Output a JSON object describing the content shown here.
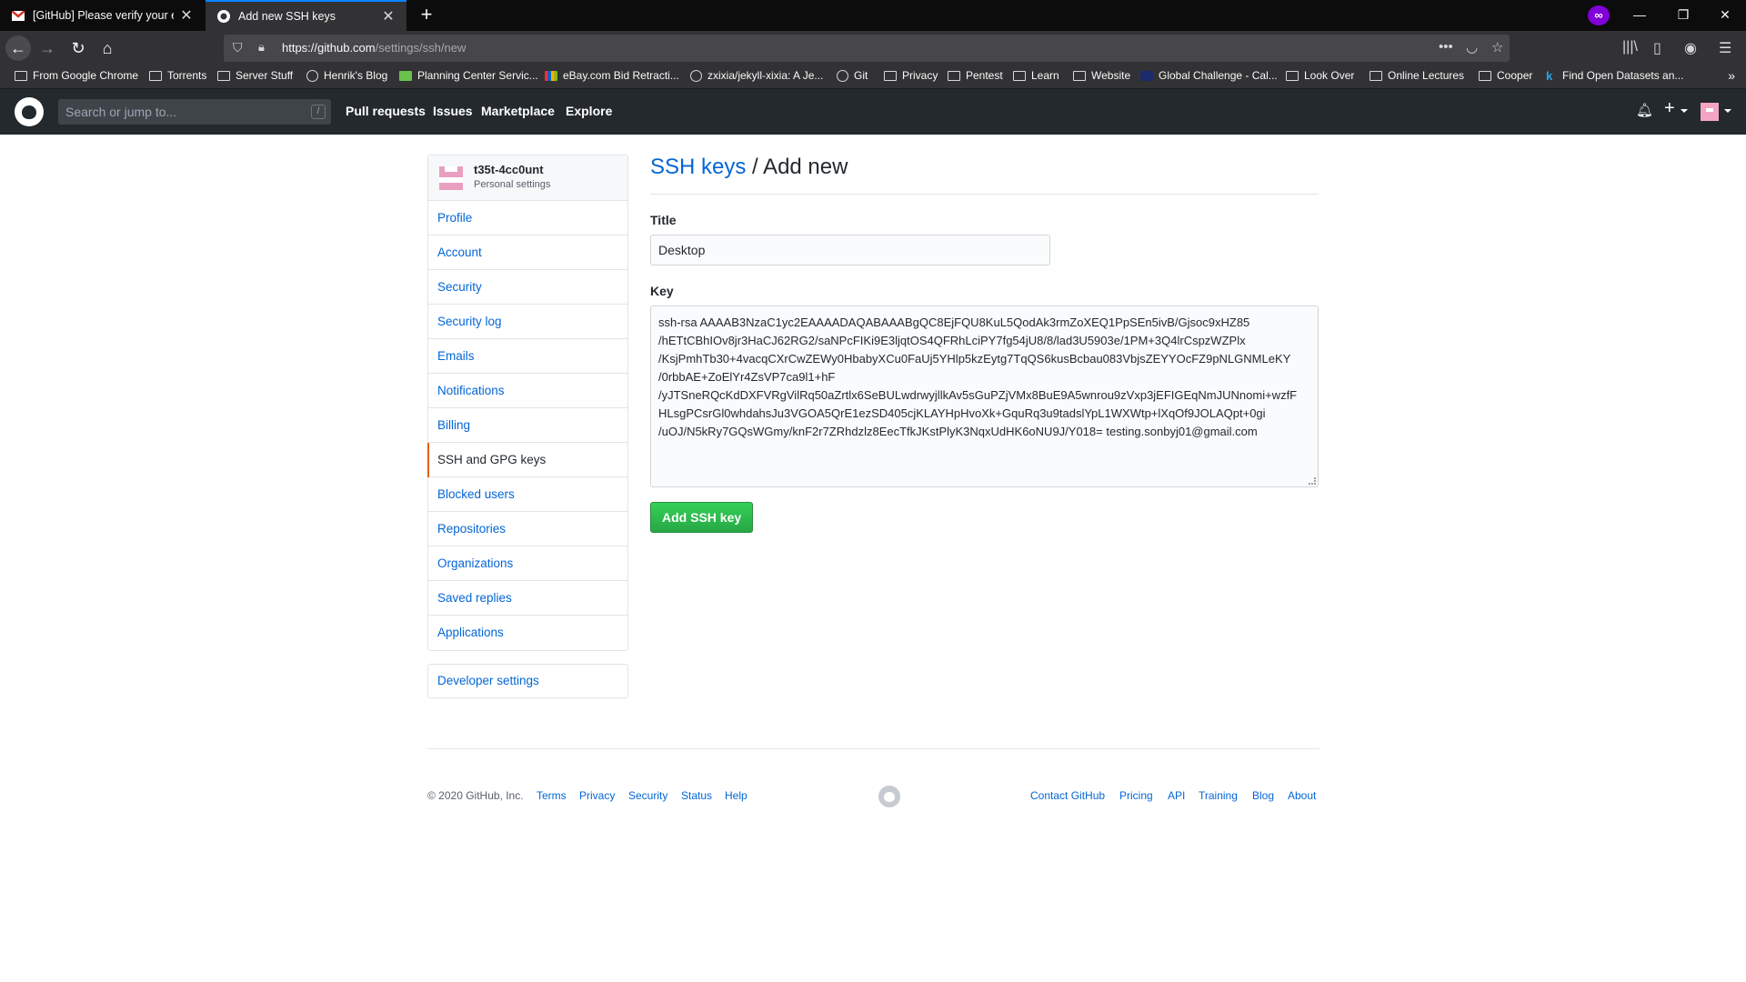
{
  "browser": {
    "tabs": [
      {
        "title": "[GitHub] Please verify your em",
        "icon": "gmail-icon"
      },
      {
        "title": "Add new SSH keys",
        "icon": "github-icon"
      }
    ],
    "url_host": "https://github.com",
    "url_path": "/settings/ssh/new",
    "bookmarks": [
      "From Google Chrome",
      "Torrents",
      "Server Stuff",
      "Henrik's Blog",
      "Planning Center Servic...",
      "eBay.com Bid Retracti...",
      "zxixia/jekyll-xixia: A Je...",
      "Git",
      "Privacy",
      "Pentest",
      "Learn",
      "Website",
      "Global Challenge - Cal...",
      "Look Over",
      "Online Lectures",
      "Cooper",
      "Find Open Datasets an..."
    ]
  },
  "github": {
    "search_placeholder": "Search or jump to...",
    "search_shortcut": "/",
    "nav": [
      "Pull requests",
      "Issues",
      "Marketplace",
      "Explore"
    ]
  },
  "sidebar": {
    "username": "t35t-4cc0unt",
    "subtitle": "Personal settings",
    "items": [
      {
        "label": "Profile",
        "selected": false
      },
      {
        "label": "Account",
        "selected": false
      },
      {
        "label": "Security",
        "selected": false
      },
      {
        "label": "Security log",
        "selected": false
      },
      {
        "label": "Emails",
        "selected": false
      },
      {
        "label": "Notifications",
        "selected": false
      },
      {
        "label": "Billing",
        "selected": false
      },
      {
        "label": "SSH and GPG keys",
        "selected": true
      },
      {
        "label": "Blocked users",
        "selected": false
      },
      {
        "label": "Repositories",
        "selected": false
      },
      {
        "label": "Organizations",
        "selected": false
      },
      {
        "label": "Saved replies",
        "selected": false
      },
      {
        "label": "Applications",
        "selected": false
      }
    ],
    "developer_settings": "Developer settings"
  },
  "main": {
    "breadcrumb_link": "SSH keys",
    "breadcrumb_current": " / Add new",
    "title_label": "Title",
    "title_value": "Desktop",
    "key_label": "Key",
    "key_value": "ssh-rsa AAAAB3NzaC1yc2EAAAADAQABAAABgQC8EjFQU8KuL5QodAk3rmZoXEQ1PpSEn5ivB/Gjsoc9xHZ85\n/hETtCBhIOv8jr3HaCJ62RG2/saNPcFIKi9E3ljqtOS4QFRhLciPY7fg54jU8/8/lad3U5903e/1PM+3Q4lrCspzWZPlx\n/KsjPmhTb30+4vacqCXrCwZEWy0HbabyXCu0FaUj5YHlp5kzEytg7TqQS6kusBcbau083VbjsZEYYOcFZ9pNLGNMLeKY\n/0rbbAE+ZoElYr4ZsVP7ca9l1+hF\n/yJTSneRQcKdDXFVRgVilRq50aZrtlx6SeBULwdrwyjllkAv5sGuPZjVMx8BuE9A5wnrou9zVxp3jEFIGEqNmJUNnomi+wzfF\nHLsgPCsrGl0whdahsJu3VGOA5QrE1ezSD405cjKLAYHpHvoXk+GquRq3u9tadslYpL1WXWtp+lXqOf9JOLAQpt+0gi\n/uOJ/N5kRy7GQsWGmy/knF2r7ZRhdzlz8EecTfkJKstPlyK3NqxUdHK6oNU9J/Y018= testing.sonbyj01@gmail.com",
    "submit_label": "Add SSH key"
  },
  "footer": {
    "copyright": "© 2020 GitHub, Inc.",
    "left_links": [
      "Terms",
      "Privacy",
      "Security",
      "Status",
      "Help"
    ],
    "right_links": [
      "Contact GitHub",
      "Pricing",
      "API",
      "Training",
      "Blog",
      "About"
    ]
  }
}
